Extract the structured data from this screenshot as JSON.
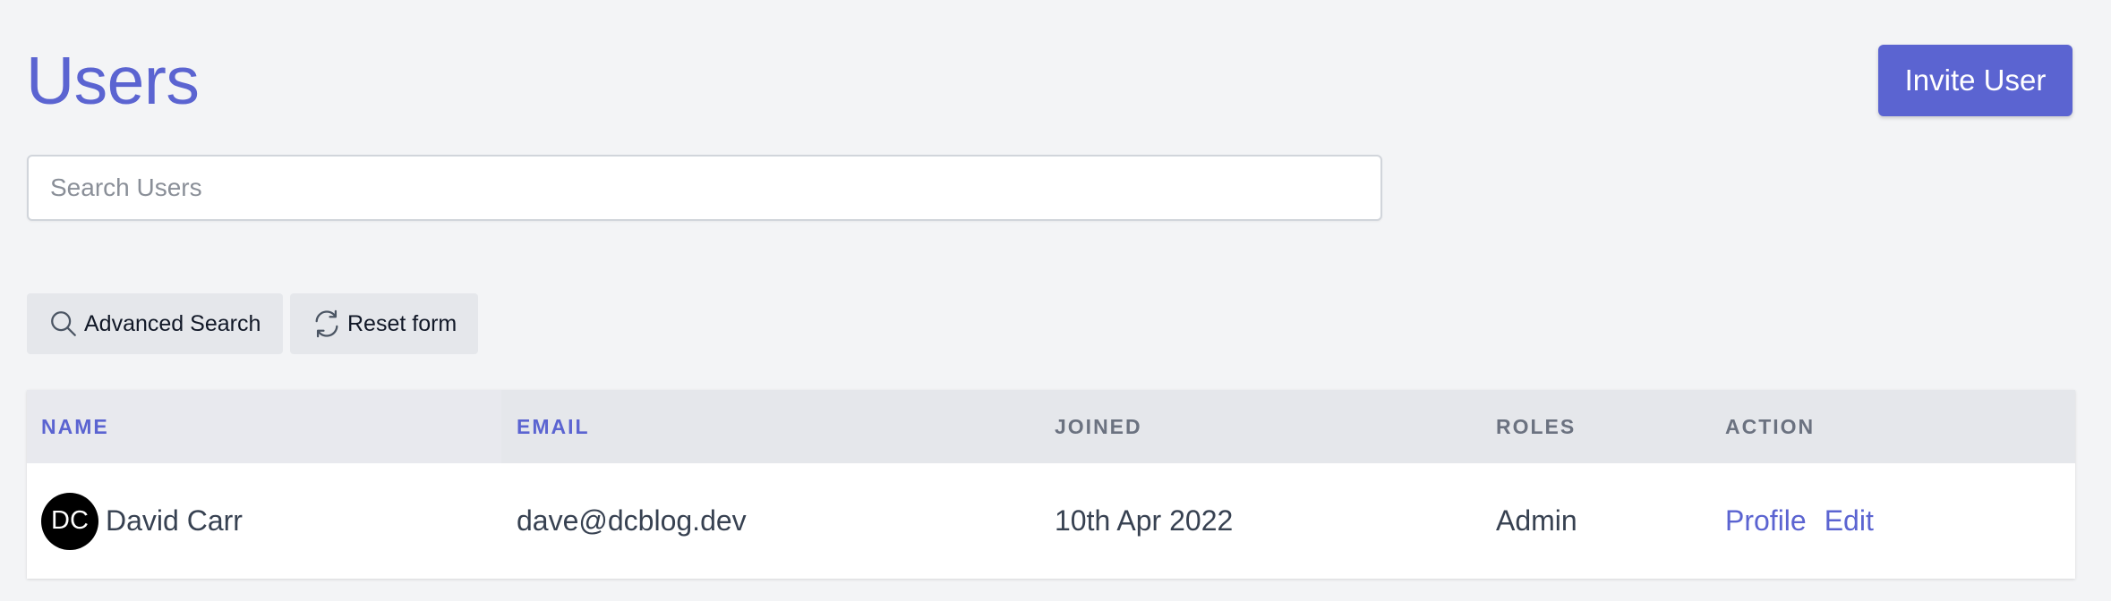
{
  "header": {
    "title": "Users",
    "invite_label": "Invite User"
  },
  "search": {
    "placeholder": "Search Users",
    "value": ""
  },
  "toolbar": {
    "advanced_search_label": "Advanced Search",
    "reset_label": "Reset form",
    "icons": [
      "search-icon",
      "refresh-icon"
    ]
  },
  "table": {
    "columns": [
      "NAME",
      "EMAIL",
      "JOINED",
      "ROLES",
      "ACTION"
    ],
    "rows": [
      {
        "avatar_initials": "DC",
        "name": "David Carr",
        "email": "dave@dcblog.dev",
        "joined": "10th Apr 2022",
        "roles": "Admin",
        "actions": [
          "Profile",
          "Edit"
        ]
      }
    ]
  },
  "colors": {
    "accent": "#5b64d1",
    "background": "#f3f4f6",
    "header_row": "#e5e7eb",
    "avatar": "#000000"
  }
}
